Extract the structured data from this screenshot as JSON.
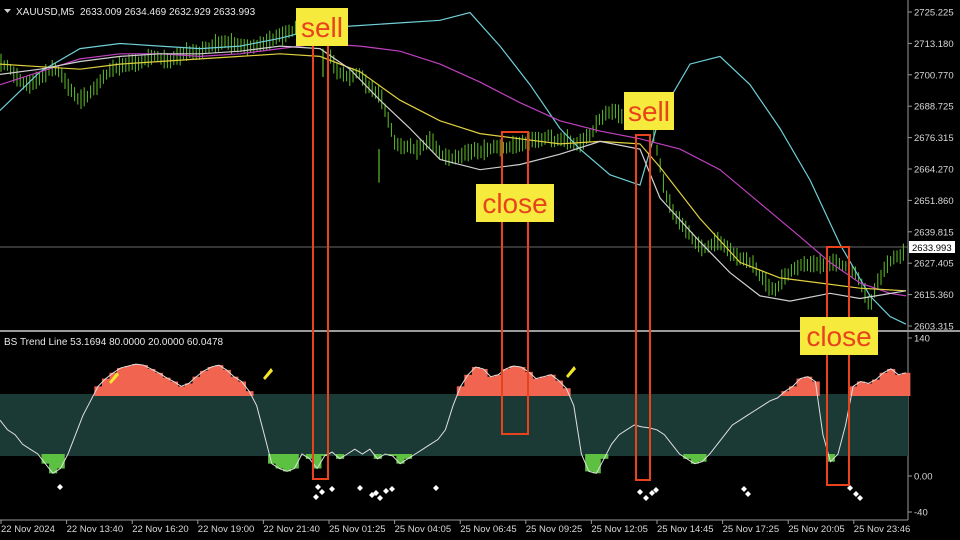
{
  "header": {
    "symbol": "XAUUSD,M5",
    "quote": "2633.009 2634.469 2632.929 2633.993"
  },
  "price_axis": {
    "ticks": [
      "2725.225",
      "2713.180",
      "2700.770",
      "2688.725",
      "2676.315",
      "2664.270",
      "2651.860",
      "2639.815",
      "2627.405",
      "2615.360",
      "2603.315"
    ],
    "current_price_label": "2633.993"
  },
  "indicator": {
    "label": "BS Trend Line 53.1694 80.0000 20.0000 60.0478",
    "ticks": [
      "140",
      "0.00",
      "-40"
    ]
  },
  "time_axis": {
    "ticks": [
      "22 Nov 2024",
      "22 Nov 13:40",
      "22 Nov 16:20",
      "22 Nov 19:00",
      "22 Nov 21:40",
      "25 Nov 01:25",
      "25 Nov 04:05",
      "25 Nov 06:45",
      "25 Nov 09:25",
      "25 Nov 12:05",
      "25 Nov 14:45",
      "25 Nov 17:25",
      "25 Nov 20:05",
      "25 Nov 23:46"
    ]
  },
  "annotations": [
    {
      "label": "sell"
    },
    {
      "label": "close"
    },
    {
      "label": "sell"
    },
    {
      "label": "close"
    }
  ],
  "colors": {
    "background": "#000000",
    "candle": "#5fbf28",
    "ma_cyan": "#6fd0d8",
    "ma_magenta": "#c040c0",
    "ma_yellow": "#e0d040",
    "ma_white": "#d0d0d0",
    "zone": "#1b3a36",
    "overbought": "#f06450",
    "oversold": "#5cc040",
    "osc_line": "#e0e0e0",
    "annotation_bg": "#f6ea3c",
    "annotation_text": "#e8431c",
    "annotation_box": "#e8431c",
    "grid": "#3a3a3a"
  },
  "chart_data": {
    "type": "line",
    "price_series": [
      2705,
      2704,
      2701,
      2698,
      2697,
      2699,
      2701,
      2703,
      2702,
      2698,
      2694,
      2691,
      2693,
      2696,
      2699,
      2702,
      2704,
      2705,
      2706,
      2705,
      2707,
      2708,
      2707,
      2706,
      2708,
      2709,
      2710,
      2709,
      2711,
      2712,
      2713,
      2714,
      2713,
      2712,
      2711,
      2712,
      2713,
      2714,
      2716,
      2717,
      2718,
      2720,
      2722,
      2720,
      2718,
      2710,
      2703,
      2701,
      2699,
      2702,
      2698,
      2695,
      2693,
      2685,
      2675,
      2672,
      2673,
      2672,
      2674,
      2676,
      2671,
      2669,
      2668,
      2669,
      2671,
      2672,
      2671,
      2672,
      2673,
      2672,
      2673,
      2674,
      2675,
      2676,
      2675,
      2677,
      2675,
      2676,
      2675,
      2674,
      2676,
      2678,
      2683,
      2686,
      2687,
      2685,
      2683,
      2684,
      2686,
      2683,
      2671,
      2656,
      2648,
      2644,
      2641,
      2636,
      2633,
      2634,
      2637,
      2635,
      2632,
      2630,
      2629,
      2627,
      2623,
      2620,
      2617,
      2621,
      2624,
      2626,
      2627,
      2627,
      2628,
      2627,
      2628,
      2627,
      2626,
      2624,
      2619,
      2611,
      2620,
      2625,
      2629,
      2630,
      2633
    ],
    "oscillator_series": [
      55,
      45,
      40,
      30,
      25,
      20,
      10,
      0,
      5,
      20,
      40,
      60,
      75,
      90,
      98,
      104,
      109,
      111,
      113,
      112,
      108,
      104,
      99,
      95,
      90,
      93,
      100,
      106,
      110,
      112,
      107,
      100,
      95,
      85,
      70,
      40,
      10,
      5,
      2,
      5,
      20,
      15,
      5,
      18,
      22,
      15,
      20,
      25,
      20,
      25,
      15,
      20,
      18,
      10,
      15,
      20,
      25,
      30,
      35,
      45,
      70,
      90,
      102,
      110,
      108,
      100,
      102,
      108,
      111,
      110,
      105,
      98,
      100,
      102,
      96,
      88,
      70,
      20,
      2,
      0,
      15,
      30,
      40,
      45,
      50,
      48,
      47,
      45,
      40,
      30,
      20,
      15,
      10,
      12,
      20,
      30,
      40,
      50,
      55,
      60,
      65,
      70,
      75,
      78,
      85,
      90,
      98,
      100,
      95,
      40,
      12,
      20,
      50,
      90,
      95,
      93,
      97,
      104,
      108,
      102,
      104
    ],
    "y_range": [
      2603.315,
      2725.225
    ],
    "oscillator_range": [
      -40,
      140
    ],
    "oscillator_bands": [
      20,
      80
    ],
    "grid": false
  }
}
